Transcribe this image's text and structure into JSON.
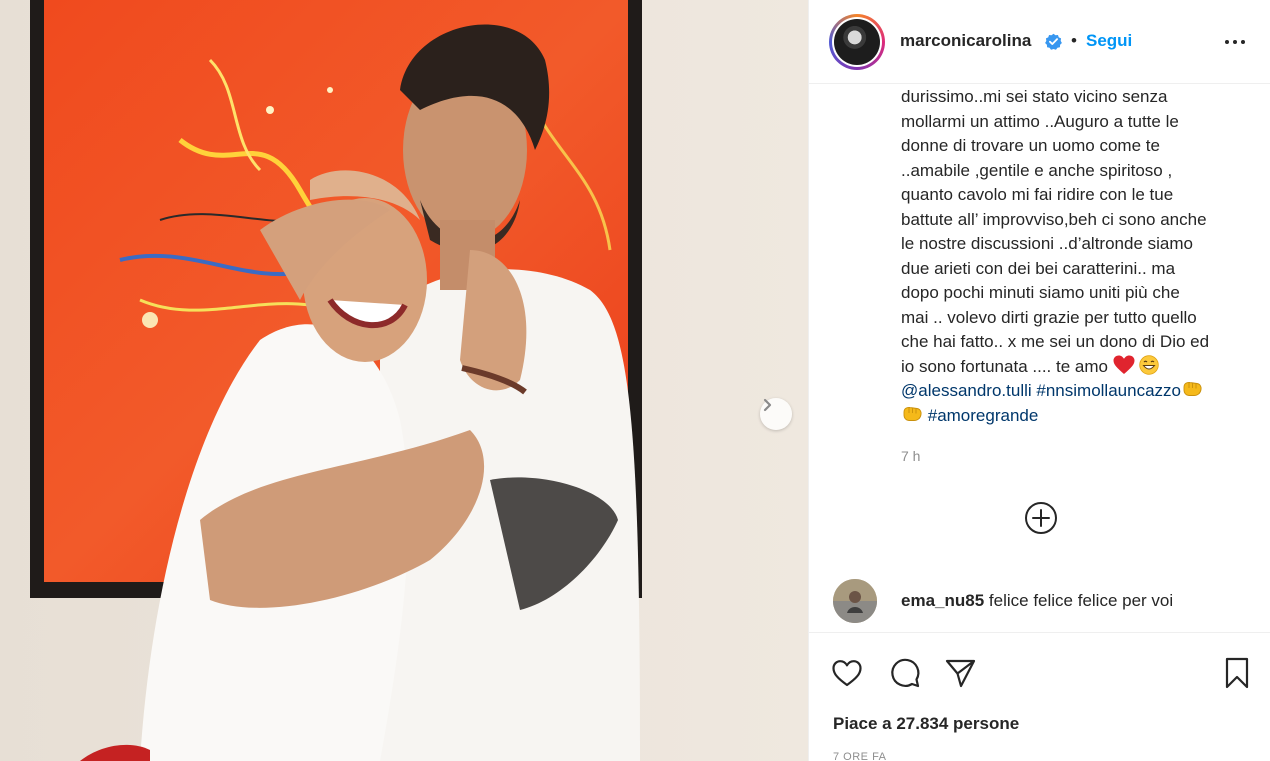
{
  "post": {
    "username": "marconicarolina",
    "follow_label": "Segui",
    "separator": "•",
    "caption_lines": [
      "durissimo..mi sei stato vicino senza",
      "mollarmi un attimo ..Auguro a tutte le",
      "donne di trovare un uomo come te",
      "..amabile ,gentile e anche spiritoso ,",
      "quanto cavolo mi fai ridire con le tue",
      "battute all’ improvviso,beh ci sono anche",
      "le nostre discussioni ..d’altronde siamo",
      "due arieti con dei bei caratterini.. ma",
      "dopo pochi minuti siamo uniti più che",
      "mai .. volevo dirti grazie per tutto quello",
      "che hai fatto.. x me sei un dono di Dio ed"
    ],
    "caption_last_text": "io sono fortunata .... te amo",
    "mention": "@alessandro.tulli",
    "hashtag1": "#nnsimollauncazzo",
    "hashtag2": "#amoregrande",
    "time_ago": "7 h",
    "comment": {
      "username": "ema_nu85",
      "text": "felice felice felice per voi"
    },
    "likes_text": "Piace a 27.834 persone",
    "date_text": "7 ORE FA"
  },
  "icons": {
    "verified": "verified-badge-icon",
    "more": "more-options-icon",
    "next": "chevron-right-icon",
    "load_more": "plus-circle-icon",
    "like": "heart-icon",
    "comment": "comment-bubble-icon",
    "share": "paper-plane-icon",
    "save": "bookmark-icon",
    "emoji_heart": "red-heart-emoji",
    "emoji_grin": "grinning-emoji",
    "emoji_fist": "oncoming-fist-emoji"
  },
  "colors": {
    "follow": "#0095f6",
    "link": "#00376b",
    "verified": "#3897f0",
    "secondary_text": "#8e8e8e"
  }
}
